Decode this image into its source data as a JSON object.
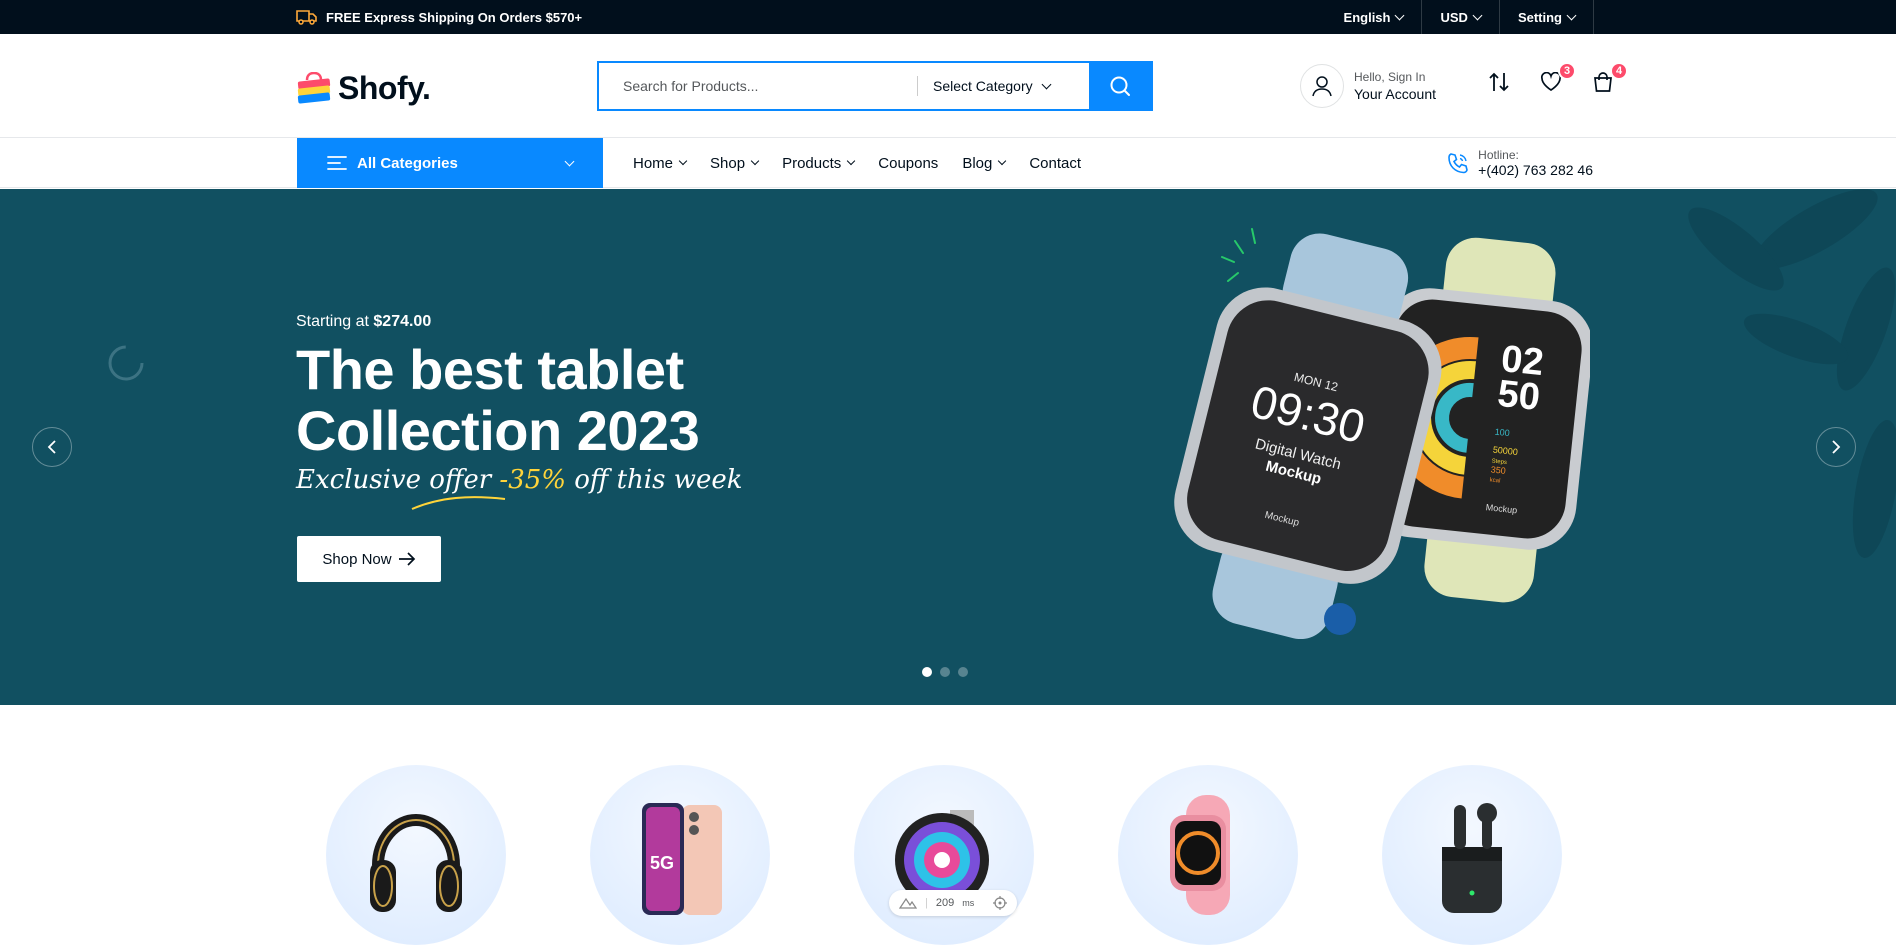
{
  "topbar": {
    "shipping_text": "FREE Express Shipping On Orders $570+",
    "language": "English",
    "currency": "USD",
    "setting": "Setting"
  },
  "header": {
    "logo_text": "Shofy.",
    "search": {
      "placeholder": "Search for Products...",
      "category": "Select Category"
    },
    "account": {
      "greeting": "Hello, Sign In",
      "label": "Your Account"
    },
    "wishlist_count": "3",
    "cart_count": "4"
  },
  "nav": {
    "all_categories": "All Categories",
    "items": [
      {
        "label": "Home"
      },
      {
        "label": "Shop"
      },
      {
        "label": "Products"
      },
      {
        "label": "Coupons"
      },
      {
        "label": "Blog"
      },
      {
        "label": "Contact"
      }
    ],
    "hotline_label": "Hotline:",
    "hotline_number": "+(402) 763 282 46"
  },
  "hero": {
    "starting_at": "Starting at",
    "price": "$274.00",
    "title_line1": "The best tablet",
    "title_line2": "Collection 2023",
    "offer_prefix": "Exclusive offer",
    "offer_pct": "-35%",
    "offer_suffix": "off this week",
    "cta": "Shop Now",
    "watch1": {
      "day": "MON 12",
      "time": "09:30",
      "line1": "Digital Watch",
      "line2": "Mockup",
      "brand": "Mockup"
    },
    "watch2": {
      "h": "02",
      "m": "50",
      "s1": "100",
      "s2": "50000",
      "s3": "Steps",
      "s4": "350",
      "s5": "kcal",
      "brand": "Mockup"
    },
    "slides": 3,
    "active_slide": 1
  },
  "perf_widget": {
    "value": "209",
    "unit": "ms"
  },
  "colors": {
    "primary": "#0989ff",
    "hero_bg": "#115061",
    "dark": "#010f1c",
    "badge": "#fd4b6b",
    "accent": "#ffd43a"
  }
}
